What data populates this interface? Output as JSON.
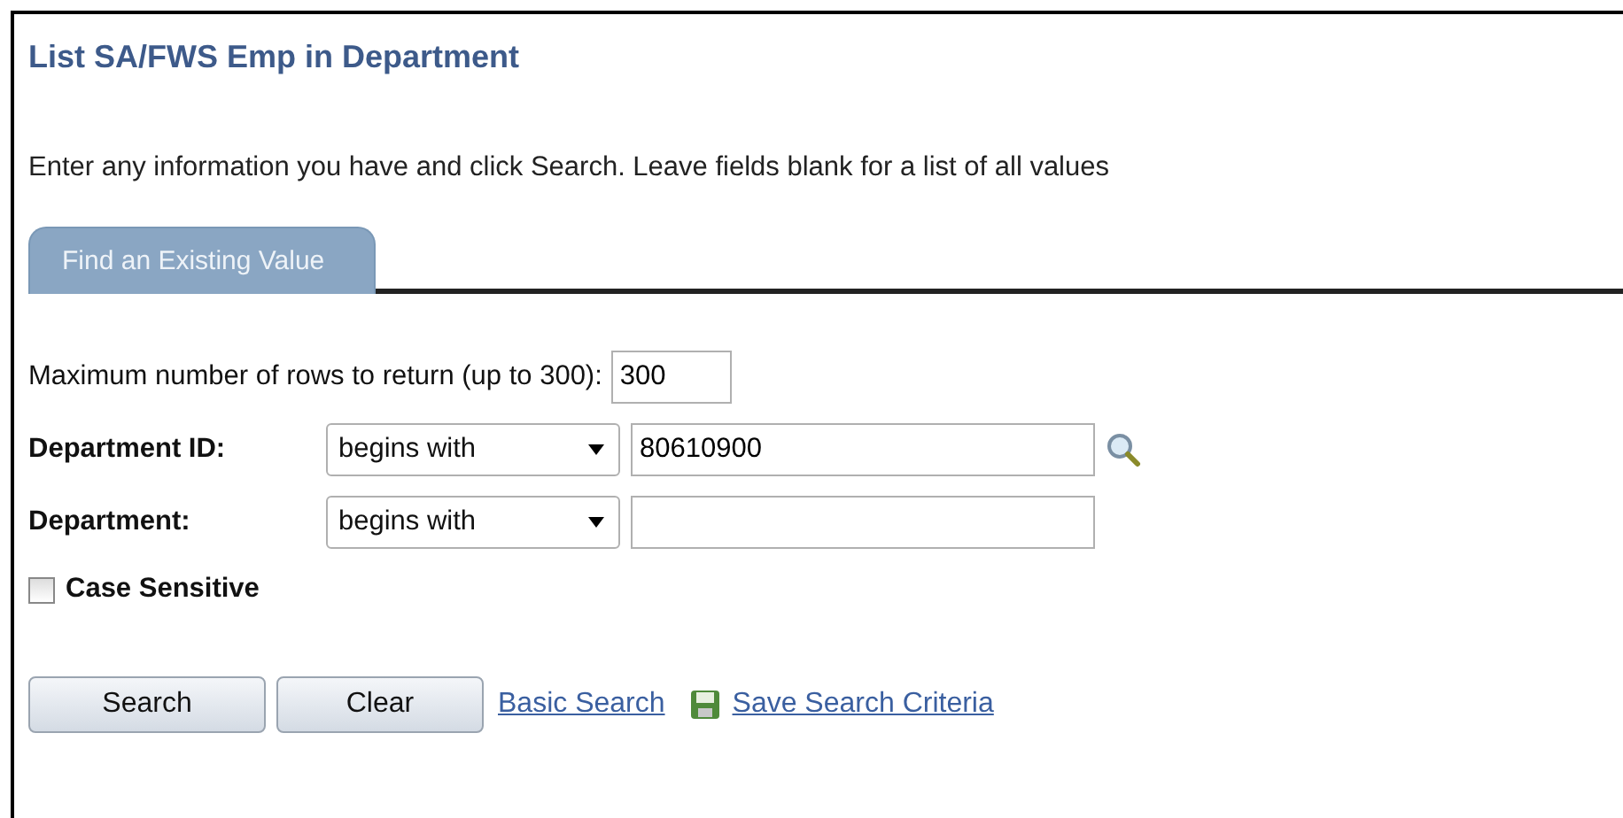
{
  "title": "List SA/FWS Emp in Department",
  "instructions": "Enter any information you have and click Search. Leave fields blank for a list of all values",
  "tab": "Find an Existing Value",
  "max_rows": {
    "label": "Maximum number of rows to return (up to 300):",
    "value": "300"
  },
  "criteria": [
    {
      "label": "Department ID:",
      "operator": "begins with",
      "value": "80610900",
      "lookup": true
    },
    {
      "label": "Department:",
      "operator": "begins with",
      "lookup": false
    }
  ],
  "case_sensitive": {
    "label": "Case Sensitive",
    "checked": false
  },
  "buttons": [
    "Search",
    "Clear"
  ],
  "links": [
    {
      "label": "Basic Search",
      "icon": false
    },
    {
      "label": "Save Search Criteria",
      "icon": true
    }
  ]
}
